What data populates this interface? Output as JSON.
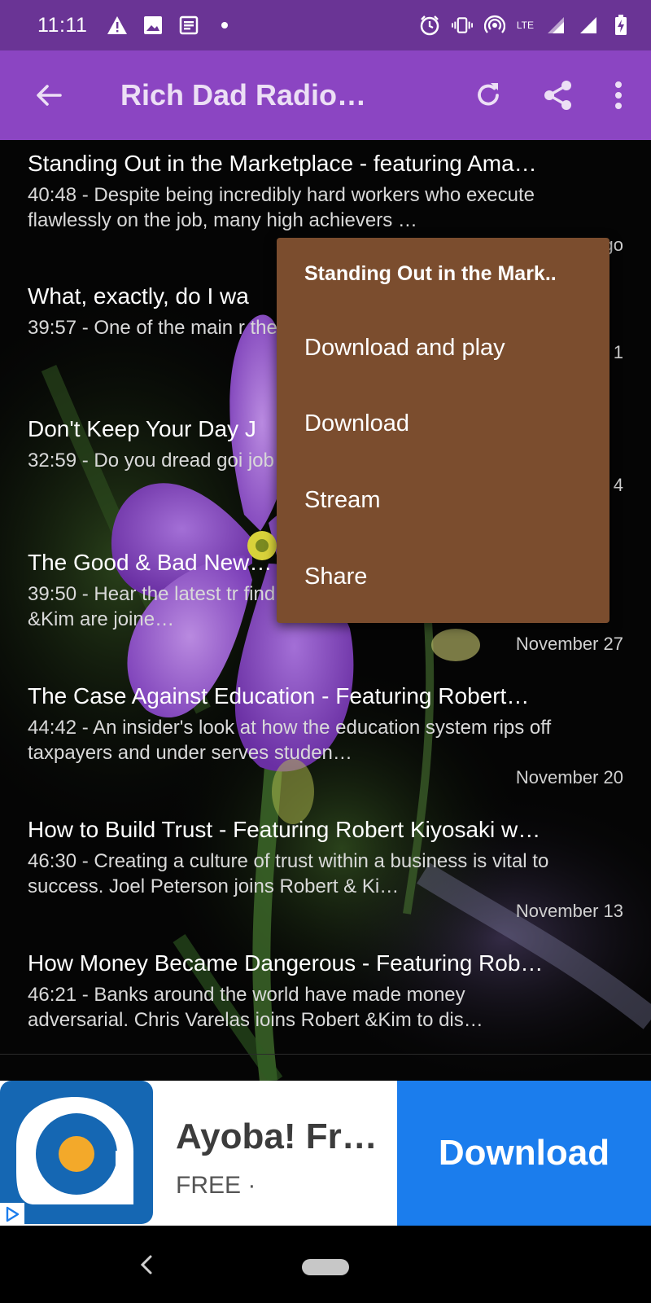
{
  "status_bar": {
    "time": "11:11",
    "icons_left": [
      "warning-icon",
      "image-icon",
      "news-icon",
      "dot-icon"
    ],
    "icons_right": [
      "alarm-icon",
      "vibrate-icon",
      "hotspot-icon",
      "lte-icon",
      "signal-icon",
      "signal-icon",
      "battery-icon"
    ],
    "lte_label": "LTE"
  },
  "app_bar": {
    "title": "Rich Dad Radio…",
    "color": "#8b45c2"
  },
  "episodes": [
    {
      "title": "Standing Out in the Marketplace - featuring Ama…",
      "desc": "40:48 - Despite being incredibly hard workers who execute flawlessly on the job, many high achievers …",
      "date": "…go"
    },
    {
      "title": "What, exactly, do I wa",
      "desc": "39:57 - One of the main r themselves stuck in a de",
      "date": "1"
    },
    {
      "title": "Don't Keep Your Day J",
      "desc": "32:59 - Do you dread goi job leave you feeling em",
      "date": "4"
    },
    {
      "title": "The Good & Bad New…",
      "desc": "39:50 - Hear the latest tr find out if we're in a bubble. Robert &Kim are joine…",
      "date": "November 27"
    },
    {
      "title": "The Case Against Education - Featuring Robert…",
      "desc": "44:42 - An insider's look at how the education system rips off taxpayers and under serves studen…",
      "date": "November 20"
    },
    {
      "title": "How to Build Trust - Featuring Robert Kiyosaki w…",
      "desc": "46:30 - Creating a culture of trust within a business is vital to success. Joel Peterson joins Robert & Ki…",
      "date": "November 13"
    },
    {
      "title": "How Money Became Dangerous - Featuring Rob…",
      "desc": "46:21 - Banks around the world have made money adversarial. Chris Varelas ioins Robert &Kim to dis…",
      "date": ""
    }
  ],
  "popup": {
    "title": "Standing Out in the Mark..",
    "items": [
      "Download and play",
      "Download",
      "Stream",
      "Share"
    ],
    "color": "#7b4d2e"
  },
  "ad": {
    "app_name": "Ayoba! Fr…",
    "price": "FREE ·",
    "button": "Download",
    "button_color": "#1b7ded"
  }
}
